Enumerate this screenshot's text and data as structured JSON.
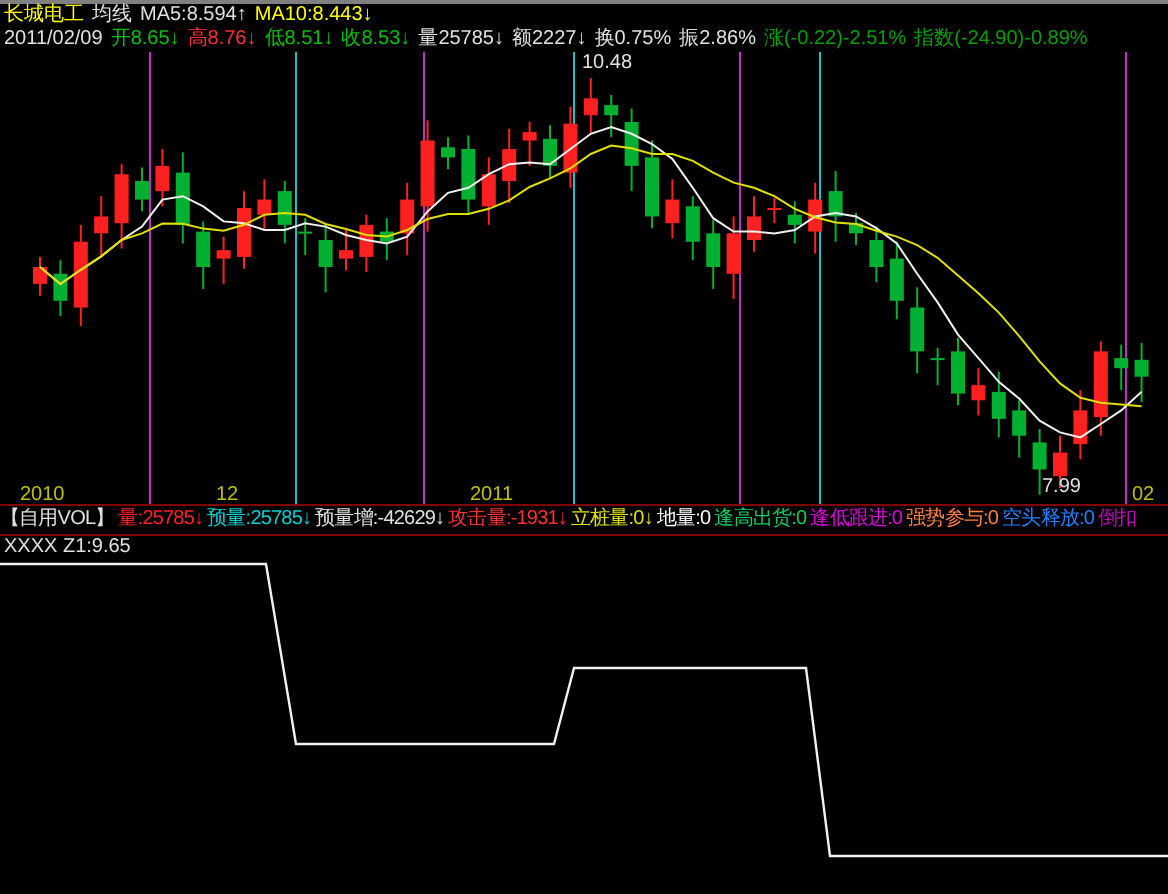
{
  "header": {
    "stock_name": "长城电工",
    "indicator": "均线",
    "ma5": "MA5:8.594↑",
    "ma10": "MA10:8.443↓"
  },
  "quote": {
    "date": "2011/02/09",
    "fields": [
      {
        "text": "开8.65↓",
        "color": "#00c000"
      },
      {
        "text": "高8.76↓",
        "color": "#ff3030"
      },
      {
        "text": "低8.51↓",
        "color": "#00c000"
      },
      {
        "text": "收8.53↓",
        "color": "#00c000"
      },
      {
        "text": "量25785↓",
        "color": "#e0e0e0"
      },
      {
        "text": "额2227↓",
        "color": "#e0e0e0"
      },
      {
        "text": "换0.75%",
        "color": "#e0e0e0"
      },
      {
        "text": "振2.86%",
        "color": "#e0e0e0"
      },
      {
        "text": "涨(-0.22)-2.51%",
        "color": "#00a000"
      },
      {
        "text": "指数(-24.90)-0.89%",
        "color": "#00a000"
      }
    ]
  },
  "price_labels": {
    "high": "10.48",
    "low": "7.99"
  },
  "x_axis": [
    "2010",
    "12",
    "2011",
    "02"
  ],
  "indicator_bar": {
    "title": "【自用VOL】",
    "items": [
      {
        "text": "量:25785↓",
        "color": "#ff2020"
      },
      {
        "text": "预量:25785↓",
        "color": "#00d0d0"
      },
      {
        "text": "预量增:-42629↓",
        "color": "#e0e0e0"
      },
      {
        "text": "攻击量:-1931↓",
        "color": "#ff3030"
      },
      {
        "text": "立桩量:0↓",
        "color": "#e0e000"
      },
      {
        "text": "地量:0",
        "color": "#ffffff"
      },
      {
        "text": "逢高出货:0",
        "color": "#00d060"
      },
      {
        "text": "逢低跟进:0",
        "color": "#e000e0"
      },
      {
        "text": "强势参与:0",
        "color": "#ff8040"
      },
      {
        "text": "空头释放:0",
        "color": "#2080ff"
      },
      {
        "text": "倒扣",
        "color": "#c000c0"
      }
    ]
  },
  "lower_panel": {
    "label": "XXXX Z1:9.65"
  }
}
